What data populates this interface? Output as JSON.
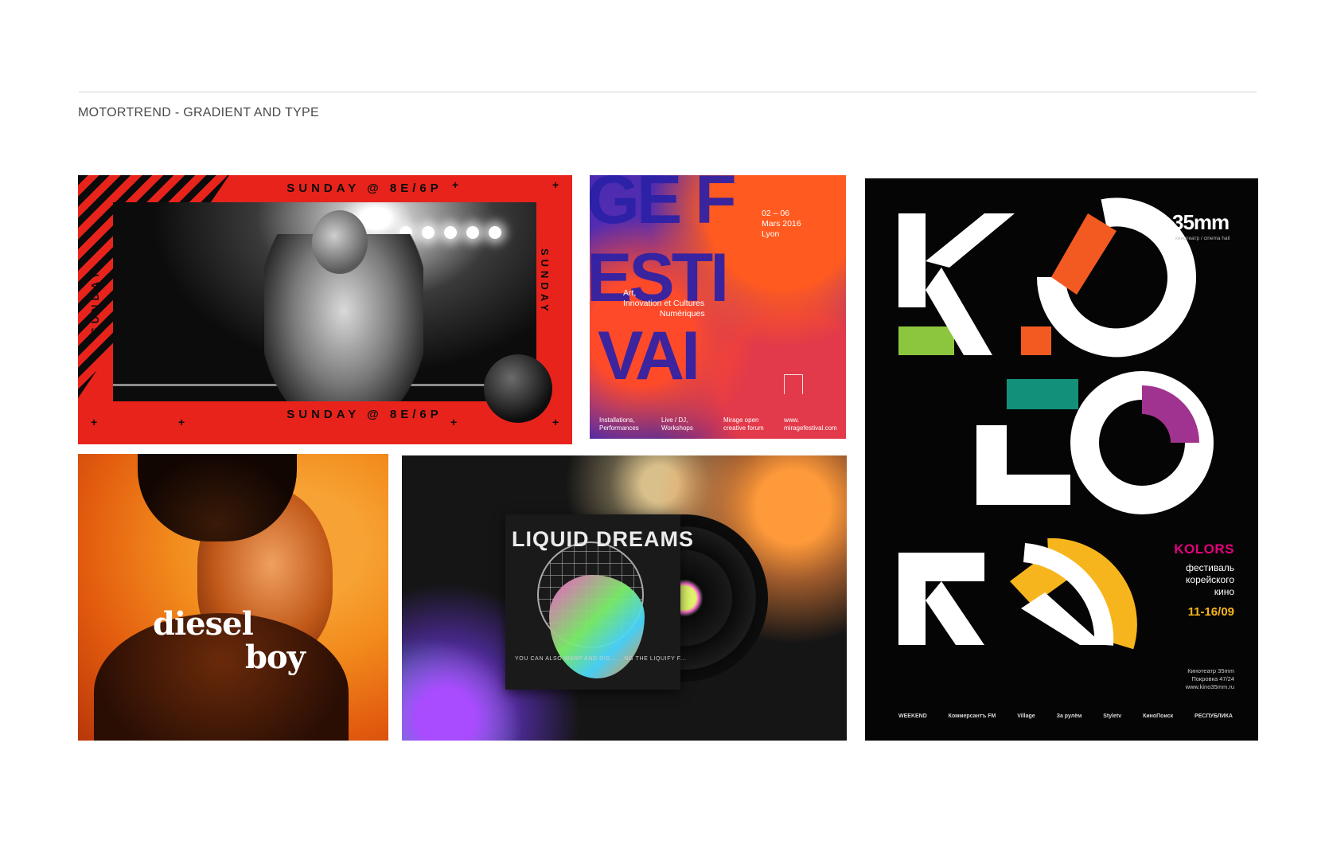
{
  "header": {
    "title": "MOTORTREND - GRADIENT AND TYPE"
  },
  "boxing": {
    "top_band": "SUNDAY @ 8E/6P",
    "bottom_band": "SUNDAY @ 8E/6P",
    "vertical_left": "SUNDAY",
    "vertical_right": "SUNDAY",
    "colors": {
      "background": "#e8231c",
      "stripe": "#0b0b0b"
    }
  },
  "festival": {
    "big_lines": [
      "GE F",
      "ESTI",
      "VAI"
    ],
    "date_line1": "02 – 06",
    "date_line2": "Mars 2016",
    "date_line3": "Lyon",
    "tagline1": "Art,",
    "tagline2": "Innovation et Cultures",
    "tagline3": "Numériques",
    "col1a": "Installations,",
    "col1b": "Performances",
    "col2a": "Live / DJ,",
    "col2b": "Workshops",
    "col3a": "Mirage open",
    "col3b": "creative forum",
    "col4a": "www.",
    "col4b": "miragefestival.com",
    "colors": {
      "type": "#2b21a8",
      "accent": "#ff5a1f"
    }
  },
  "diesel": {
    "word1": "diesel",
    "word2": "boy"
  },
  "liquid": {
    "album_title": "LIQUID DREAMS",
    "tagline": "YOU CAN ALSO WARP AND DIS... ...NG THE LIQUIFY F..."
  },
  "kolors": {
    "cinema_logo": "35mm",
    "cinema_sub": "кинотеатр / cinema hall",
    "brand": "KOLORS",
    "desc1": "фестиваль",
    "desc2": "корейского",
    "desc3": "кино",
    "dates": "11-16/09",
    "address1": "Кинотеатр 35mm",
    "address2": "Покровка 47/24",
    "address3": "www.kino35mm.ru",
    "sponsors": [
      "WEEKEND",
      "Коммерсантъ FM",
      "Village",
      "За рулём",
      "Styletv",
      "КиноПоиск",
      "РЕСПУБЛИКА"
    ],
    "colors": {
      "green": "#8cc63f",
      "orange": "#f25a22",
      "teal": "#12907a",
      "purple": "#a0338f",
      "yellow": "#f7b51d",
      "brand_pink": "#e6007e"
    }
  }
}
